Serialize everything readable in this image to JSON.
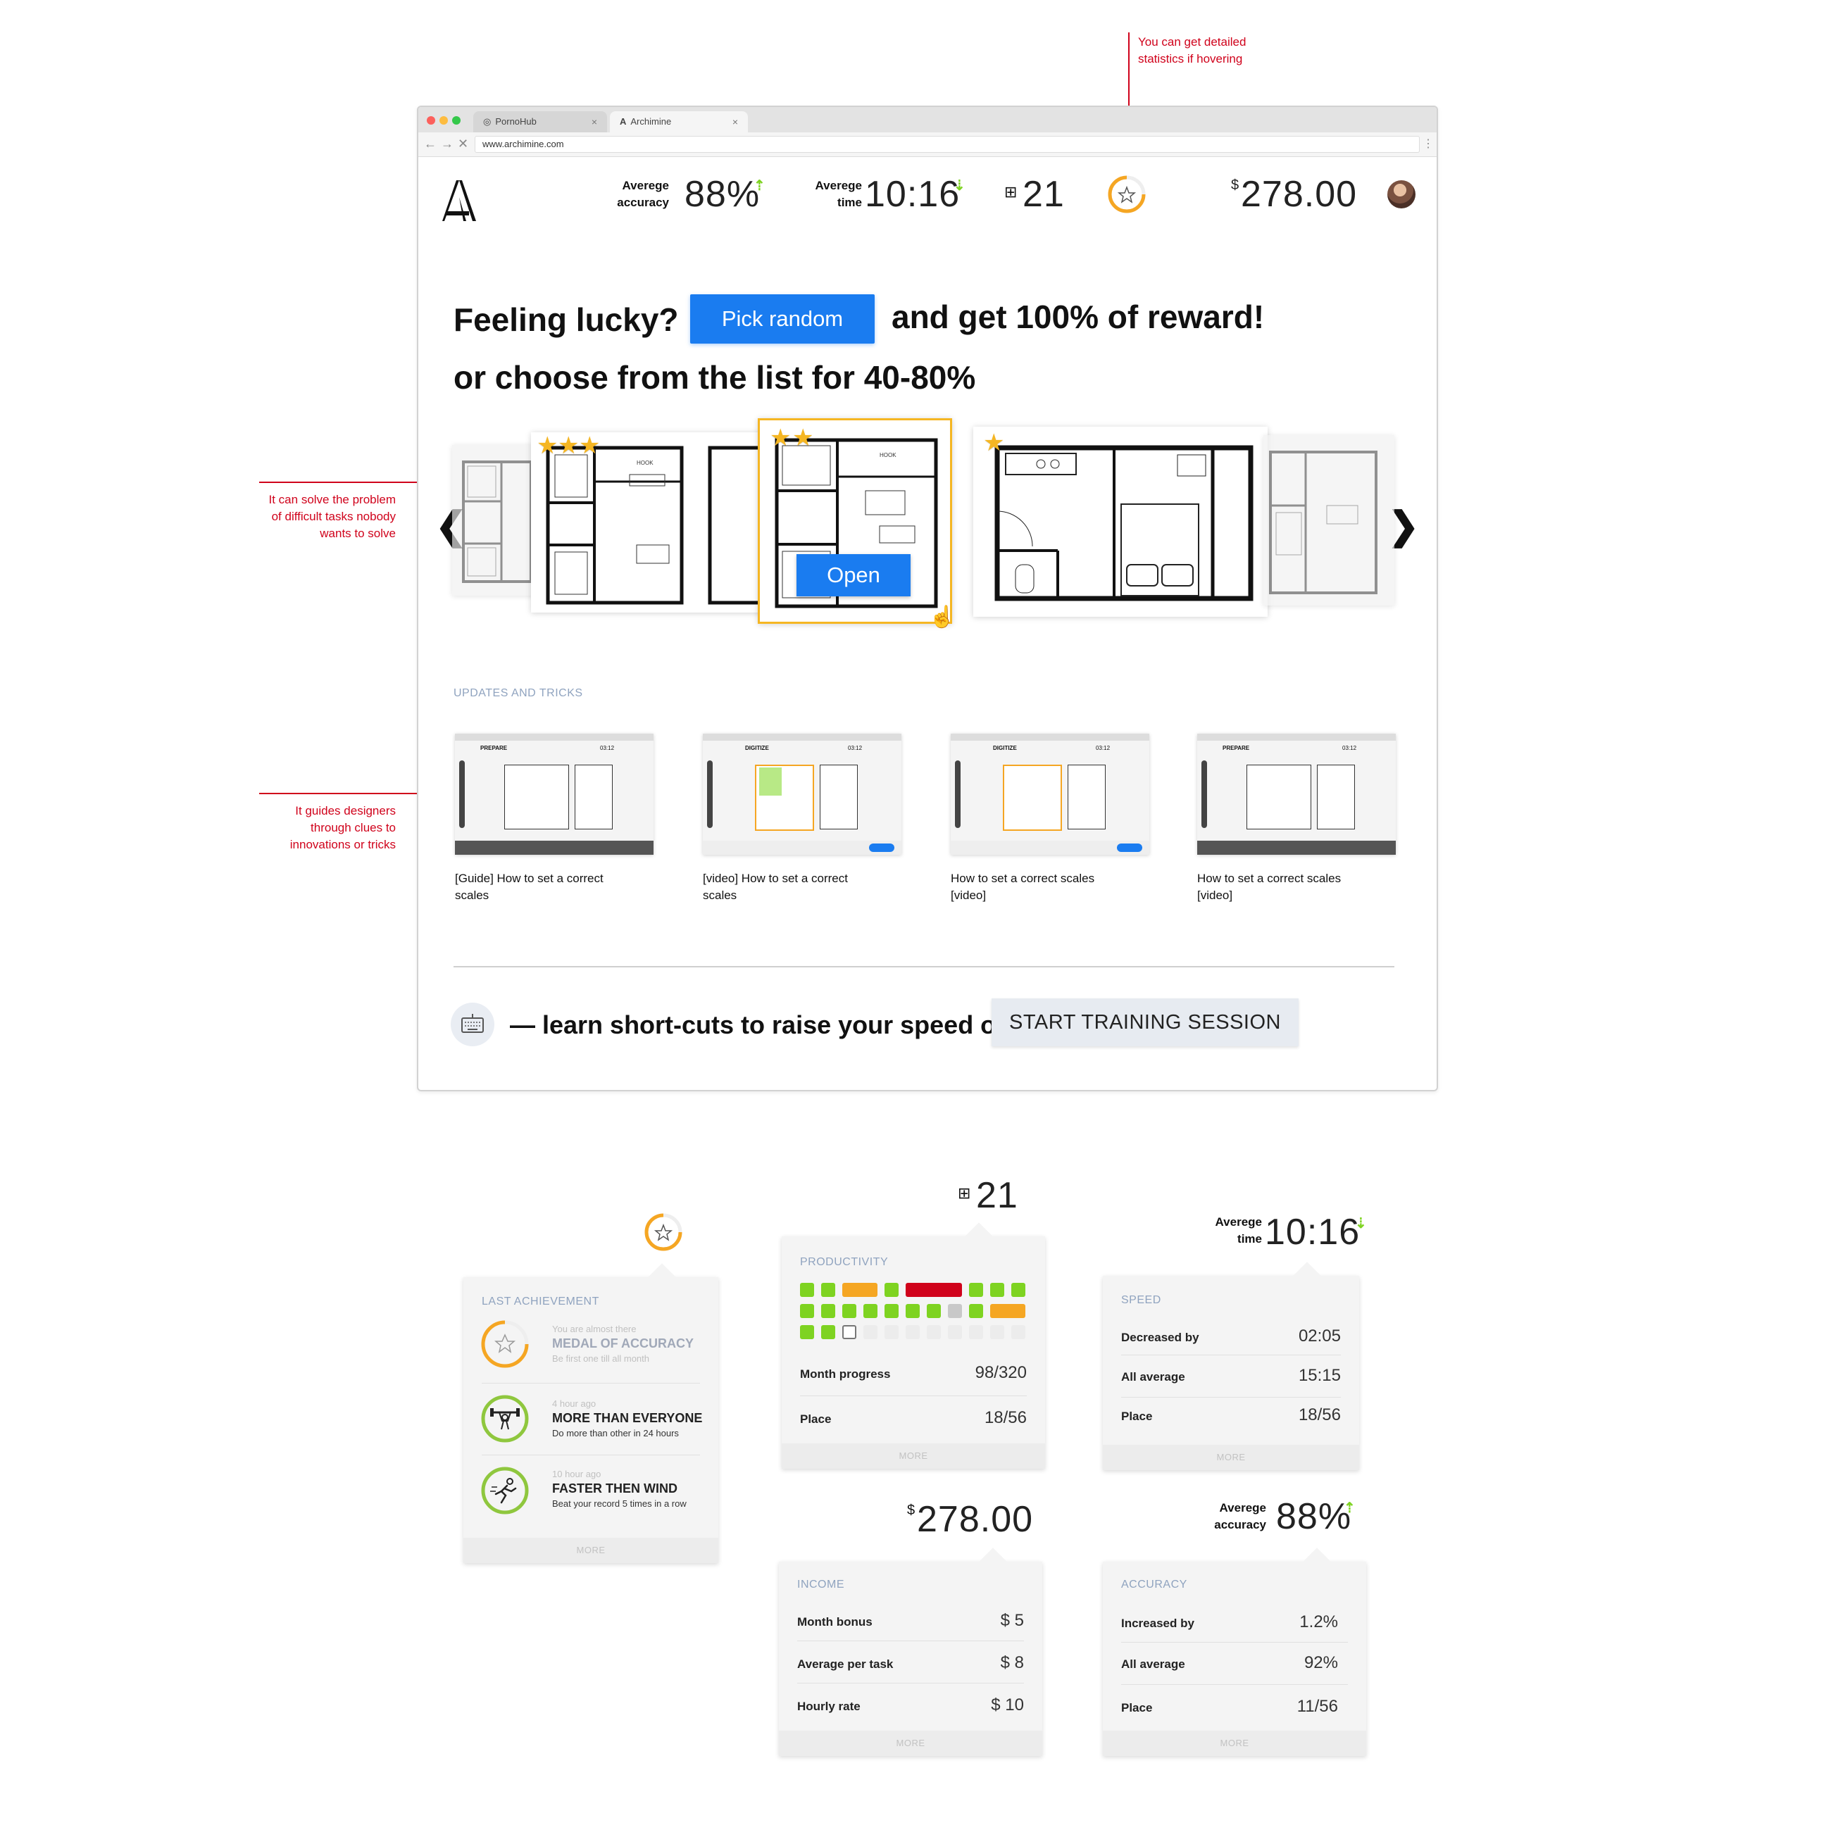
{
  "annotations": {
    "hover_stats": "You can get detailed\nstatistics if hovering",
    "difficult_tasks": "It can solve the problem\nof difficult tasks nobody\nwants to solve",
    "guides": "It guides designers\nthrough clues to\ninnovations or tricks"
  },
  "browser": {
    "tabs": [
      {
        "label": "PornoHub",
        "close": "×"
      },
      {
        "label": "Archimine",
        "close": "×"
      }
    ],
    "url": "www.archimine.com"
  },
  "header": {
    "accuracy_label": "Averege\naccuracy",
    "accuracy_value": "88%",
    "time_label": "Averege\ntime",
    "time_value": "10:16",
    "tasks_value": "21",
    "money_currency": "$",
    "money_value": "278.00"
  },
  "hero": {
    "line1_start": "Feeling lucky?",
    "pick_button": "Pick random",
    "line1_end": "and get 100% of reward!",
    "line2": "or choose from the list for 40-80%"
  },
  "carousel": {
    "prev": "❮",
    "next": "❯",
    "open_button": "Open",
    "plan_label": "HOOK",
    "cards": [
      {
        "stars": 0
      },
      {
        "stars": 3
      },
      {
        "stars": 2
      },
      {
        "stars": 1
      },
      {
        "stars": 0
      }
    ]
  },
  "updates": {
    "section_label": "UPDATES AND TRICKS",
    "thumb_steps": [
      "PREPARE",
      "DIGITIZE",
      "DIGITIZE",
      "PREPARE"
    ],
    "thumb_timer": "03:12",
    "items": [
      {
        "title": "[Guide] How to set a correct\nscales"
      },
      {
        "title": "[video] How to set a correct\nscales"
      },
      {
        "title": "How to set a correct scales\n[video]"
      },
      {
        "title": "How to set a correct scales\n[video]"
      }
    ]
  },
  "training": {
    "text": "— learn short-cuts to raise your speed or",
    "button": "START TRAINING SESSION"
  },
  "popovers": {
    "achievements": {
      "title": "LAST ACHIEVEMENT",
      "items": [
        {
          "small": "You are almost there",
          "title": "MEDAL OF ACCURACY",
          "sub": "Be first one till all month"
        },
        {
          "small": "4 hour ago",
          "title": "MORE THAN EVERYONE",
          "sub": "Do more than other in 24 hours"
        },
        {
          "small": "10 hour ago",
          "title": "FASTER THEN WIND",
          "sub": "Beat your record 5 times in a row"
        }
      ],
      "more": "MORE"
    },
    "productivity": {
      "header_value": "21",
      "title": "PRODUCTIVITY",
      "rows": [
        {
          "label": "Month progress",
          "value": "98/320"
        },
        {
          "label": "Place",
          "value": "18/56"
        }
      ],
      "more": "MORE"
    },
    "speed": {
      "header_label": "Averege\ntime",
      "header_value": "10:16",
      "title": "SPEED",
      "rows": [
        {
          "label": "Decreased by",
          "value": "02:05"
        },
        {
          "label": "All average",
          "value": "15:15"
        },
        {
          "label": "Place",
          "value": "18/56"
        }
      ],
      "more": "MORE"
    },
    "income": {
      "header_currency": "$",
      "header_value": "278.00",
      "title": "INCOME",
      "rows": [
        {
          "label": "Month bonus",
          "value": "$ 5"
        },
        {
          "label": "Average per task",
          "value": "$ 8"
        },
        {
          "label": "Hourly rate",
          "value": "$ 10"
        }
      ],
      "more": "MORE"
    },
    "accuracy": {
      "header_label": "Averege\naccuracy",
      "header_value": "88%",
      "title": "ACCURACY",
      "rows": [
        {
          "label": "Increased by",
          "value": "1.2%"
        },
        {
          "label": "All average",
          "value": "92%"
        },
        {
          "label": "Place",
          "value": "11/56"
        }
      ],
      "more": "MORE"
    }
  },
  "colors": {
    "accent_blue": "#1a7cf0",
    "annotation_red": "#d0021b",
    "up_green": "#7ed321",
    "star_gold": "#f5b623",
    "prod_green": "#7ed321",
    "prod_orange": "#f5a623",
    "prod_red": "#d0021b",
    "prod_gray": "#c8c8c8"
  }
}
